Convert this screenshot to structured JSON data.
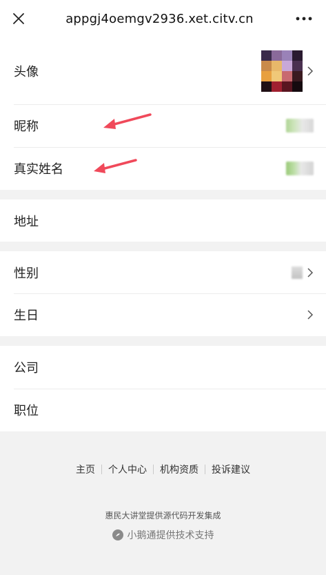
{
  "topbar": {
    "url": "appgj4oemgv2936.xet.citv.cn",
    "close_icon": "close-icon",
    "more_icon": "more-icon"
  },
  "profile": {
    "avatar_label": "头像",
    "nickname_label": "昵称",
    "realname_label": "真实姓名",
    "address_label": "地址",
    "gender_label": "性别",
    "birthday_label": "生日",
    "company_label": "公司",
    "position_label": "职位"
  },
  "annotations": {
    "arrow_color": "#f0495a"
  },
  "footer": {
    "links": [
      "主页",
      "个人中心",
      "机构资质",
      "投诉建议"
    ],
    "integrate_text": "惠民大讲堂提供源代码开发集成",
    "powered_text": "小鹅通提供技术支持"
  }
}
